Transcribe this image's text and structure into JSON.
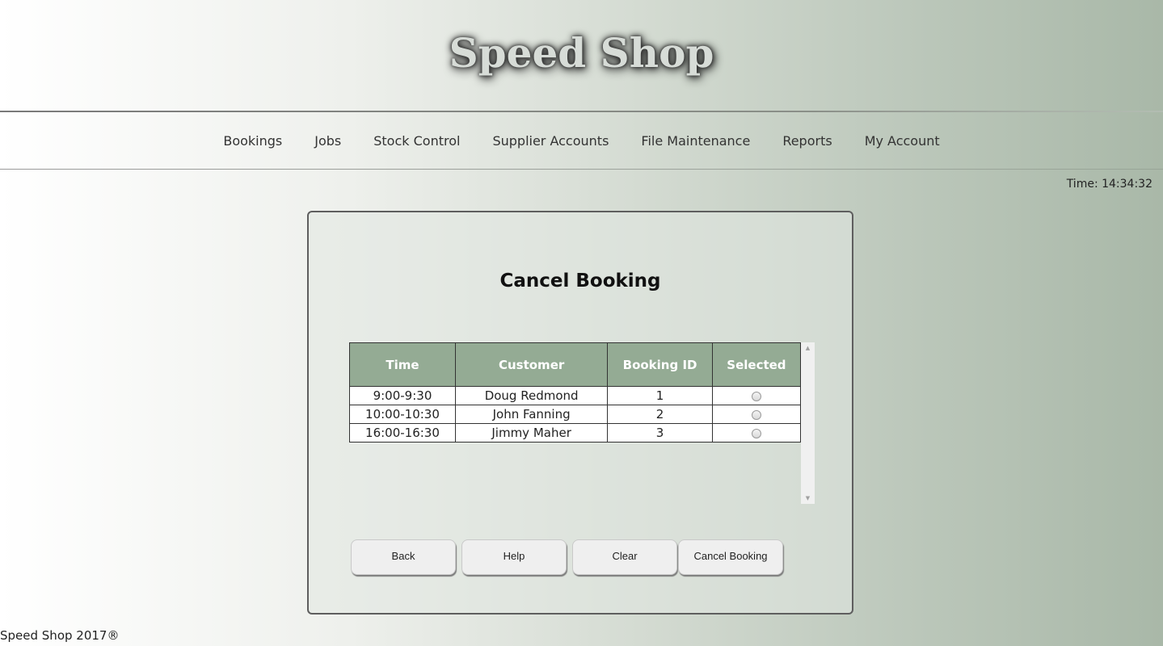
{
  "brand": {
    "title": "Speed Shop"
  },
  "nav": {
    "items": [
      "Bookings",
      "Jobs",
      "Stock Control",
      "Supplier Accounts",
      "File Maintenance",
      "Reports",
      "My Account"
    ]
  },
  "clock": {
    "text": "Time: 14:34:32"
  },
  "panel": {
    "title": "Cancel Booking",
    "table": {
      "headers": [
        "Time",
        "Customer",
        "Booking ID",
        "Selected"
      ],
      "rows": [
        {
          "time": "9:00-9:30",
          "customer": "Doug Redmond",
          "id": "1"
        },
        {
          "time": "10:00-10:30",
          "customer": "John Fanning",
          "id": "2"
        },
        {
          "time": "16:00-16:30",
          "customer": "Jimmy Maher",
          "id": "3"
        }
      ]
    },
    "buttons": {
      "back": "Back",
      "help": "Help",
      "clear": "Clear",
      "cancel": "Cancel Booking"
    }
  },
  "footer": {
    "text": "Speed Shop 2017®"
  },
  "colors": {
    "table_header": "#94ab94",
    "panel_border": "#5e5e5e"
  }
}
